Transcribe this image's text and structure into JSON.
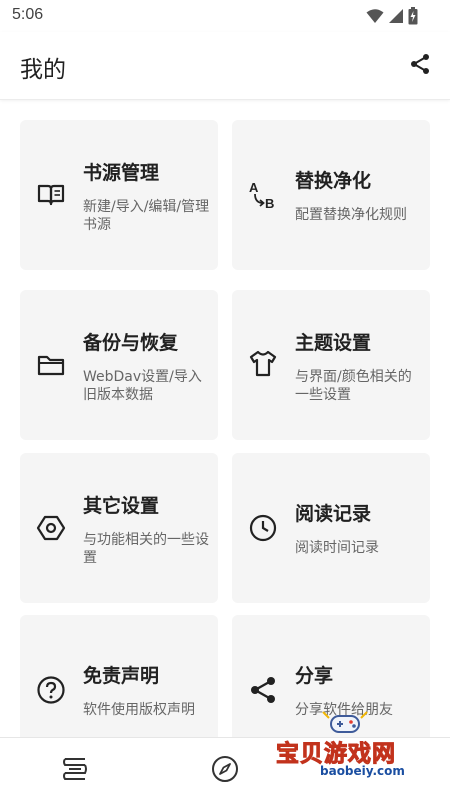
{
  "status_bar": {
    "time": "5:06"
  },
  "app_bar": {
    "title": "我的"
  },
  "cards": [
    {
      "title": "书源管理",
      "desc": "新建/导入/编辑/管理书源",
      "icon": "book-icon"
    },
    {
      "title": "替换净化",
      "desc": "配置替换净化规则",
      "icon": "replace-ab-icon"
    },
    {
      "title": "备份与恢复",
      "desc": "WebDav设置/导入旧版本数据",
      "icon": "folder-icon"
    },
    {
      "title": "主题设置",
      "desc": "与界面/颜色相关的一些设置",
      "icon": "tshirt-icon"
    },
    {
      "title": "其它设置",
      "desc": "与功能相关的一些设置",
      "icon": "hex-settings-icon"
    },
    {
      "title": "阅读记录",
      "desc": "阅读时间记录",
      "icon": "clock-icon"
    },
    {
      "title": "免责声明",
      "desc": "软件使用版权声明",
      "icon": "help-circle-icon"
    },
    {
      "title": "分享",
      "desc": "分享软件给朋友",
      "icon": "share-icon"
    }
  ],
  "icons": {
    "ab_a": "A",
    "ab_b": "B"
  },
  "bottom_nav": [
    {
      "icon": "bookshelf-icon"
    },
    {
      "icon": "compass-icon"
    }
  ],
  "watermark": {
    "main": "宝贝游戏网",
    "sub": "baobeiy.com"
  }
}
